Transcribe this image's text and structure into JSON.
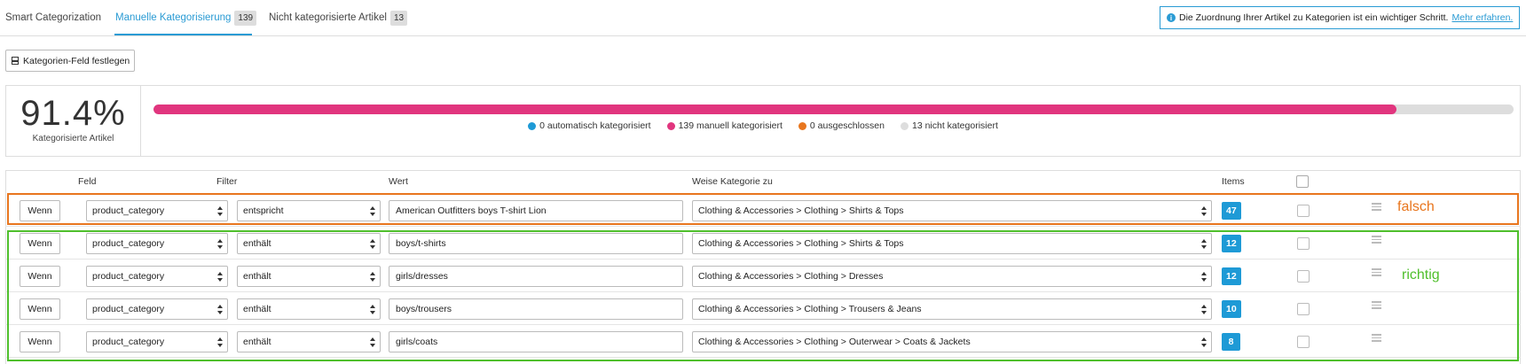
{
  "tabs": [
    {
      "label": "Smart Categorization",
      "count": null,
      "active": false
    },
    {
      "label": "Manuelle Kategorisierung",
      "count": "139",
      "active": true
    },
    {
      "label": "Nicht kategorisierte Artikel",
      "count": "13",
      "active": false
    }
  ],
  "info": {
    "text": "Die Zuordnung Ihrer Artikel zu Kategorien ist ein wichtiger Schritt.",
    "link": "Mehr erfahren."
  },
  "set_field_button": "Kategorien-Feld festlegen",
  "stats": {
    "percentage": "91.4%",
    "label": "Kategorisierte Artikel",
    "progress_fraction": 0.914,
    "legend": [
      {
        "label": "0 automatisch kategorisiert",
        "color": "#1e9ad6"
      },
      {
        "label": "139 manuell kategorisiert",
        "color": "#e1357e"
      },
      {
        "label": "0 ausgeschlossen",
        "color": "#e8761e"
      },
      {
        "label": "13 nicht kategorisiert",
        "color": "#dddddd"
      }
    ]
  },
  "table": {
    "headers": {
      "field": "Feld",
      "filter": "Filter",
      "value": "Wert",
      "category": "Weise Kategorie zu",
      "items": "Items"
    },
    "rows": [
      {
        "condition": "Wenn",
        "field": "product_category",
        "filter": "entspricht",
        "value": "American Outfitters boys T-shirt Lion",
        "category": "Clothing & Accessories > Clothing > Shirts & Tops",
        "items": "47"
      },
      {
        "condition": "Wenn",
        "field": "product_category",
        "filter": "enthält",
        "value": "boys/t-shirts",
        "category": "Clothing & Accessories > Clothing > Shirts & Tops",
        "items": "12"
      },
      {
        "condition": "Wenn",
        "field": "product_category",
        "filter": "enthält",
        "value": "girls/dresses",
        "category": "Clothing & Accessories > Clothing > Dresses",
        "items": "12"
      },
      {
        "condition": "Wenn",
        "field": "product_category",
        "filter": "enthält",
        "value": "boys/trousers",
        "category": "Clothing & Accessories > Clothing > Trousers & Jeans",
        "items": "10"
      },
      {
        "condition": "Wenn",
        "field": "product_category",
        "filter": "enthält",
        "value": "girls/coats",
        "category": "Clothing & Accessories > Clothing > Outerwear > Coats & Jackets",
        "items": "8"
      }
    ]
  },
  "annotations": {
    "wrong": {
      "label": "falsch",
      "color": "#e8761e"
    },
    "right": {
      "label": "richtig",
      "color": "#4fbf2c"
    }
  }
}
